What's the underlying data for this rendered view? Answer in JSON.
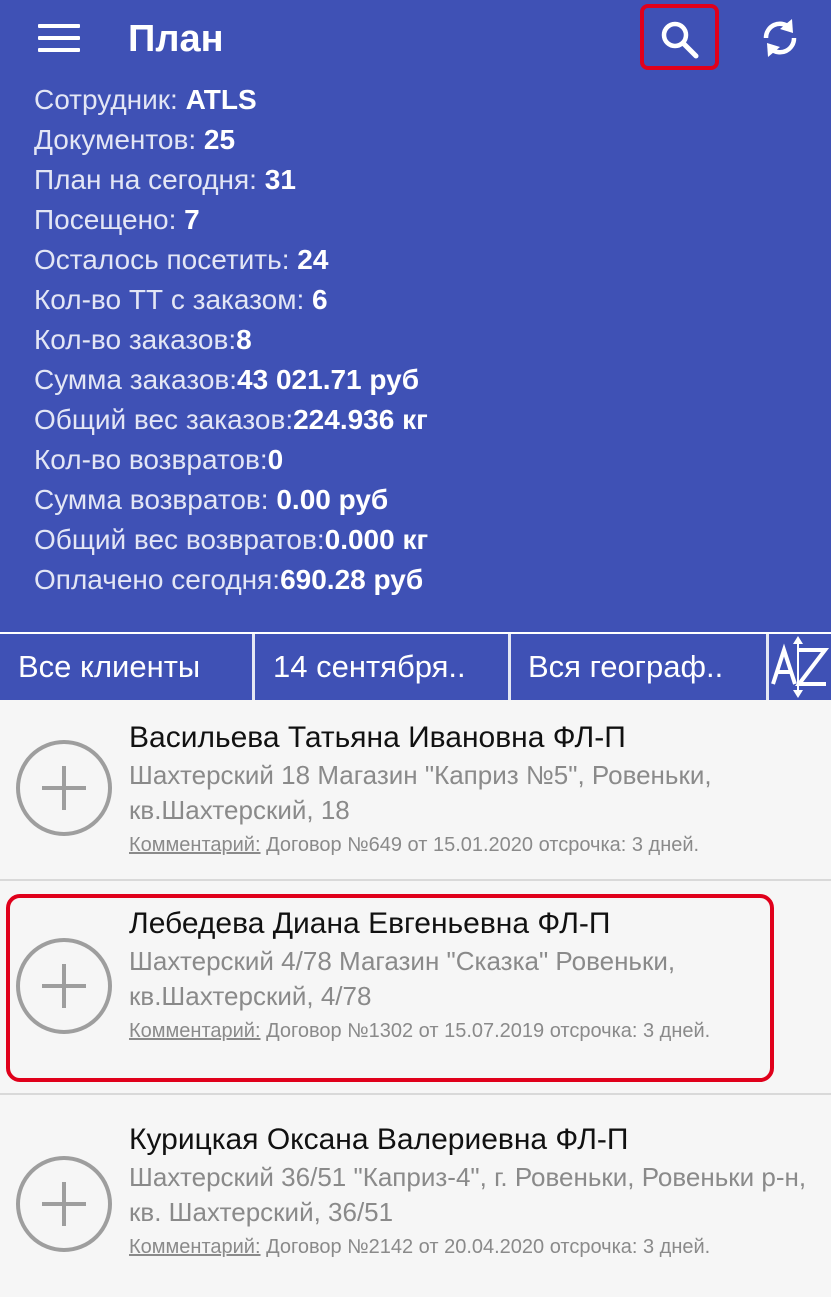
{
  "header": {
    "title": "План",
    "icons": {
      "menu": "menu-icon",
      "search": "search-icon",
      "sync": "sync-icon"
    },
    "highlight_color": "#e0001b",
    "background_color": "#3f51b5"
  },
  "stats": [
    {
      "label": "Сотрудник: ",
      "value": "ATLS"
    },
    {
      "label": "Документов: ",
      "value": "25"
    },
    {
      "label": "План на сегодня: ",
      "value": "31"
    },
    {
      "label": "Посещено: ",
      "value": "7"
    },
    {
      "label": "Осталось посетить: ",
      "value": "24"
    },
    {
      "label": "Кол-во ТТ с заказом: ",
      "value": "6"
    },
    {
      "label": "Кол-во заказов:",
      "value": "8"
    },
    {
      "label": "Сумма заказов:",
      "value": "43 021.71 руб"
    },
    {
      "label": "Общий вес заказов:",
      "value": "224.936 кг"
    },
    {
      "label": "Кол-во возвратов:",
      "value": "0"
    },
    {
      "label": "Сумма возвратов: ",
      "value": "0.00 руб"
    },
    {
      "label": "Общий вес возвратов:",
      "value": "0.000 кг"
    },
    {
      "label": "Оплачено сегодня:",
      "value": "690.28 руб"
    }
  ],
  "filters": {
    "clients": "Все клиенты",
    "date": "14 сентября..",
    "geography": "Вся географ..",
    "sort_icon": "sort-az-icon"
  },
  "clients": [
    {
      "name": "Васильева Татьяна Ивановна ФЛ-П",
      "address": "Шахтерский 18 Магазин \"Каприз №5\", Ровеньки, кв.Шахтерский, 18",
      "comment_label": "Комментарий:",
      "comment": " Договор №649 от 15.01.2020 отсрочка: 3 дней."
    },
    {
      "name": "Лебедева Диана Евгеньевна ФЛ-П",
      "address": "Шахтерский 4/78 Магазин \"Сказка\" Ровеньки, кв.Шахтерский, 4/78",
      "comment_label": "Комментарий:",
      "comment": " Договор №1302 от 15.07.2019 отсрочка: 3 дней."
    },
    {
      "name": "Курицкая Оксана Валериевна ФЛ-П",
      "address": "Шахтерский 36/51 \"Каприз-4\", г. Ровеньки, Ровеньки р-н, кв. Шахтерский, 36/51",
      "comment_label": "Комментарий:",
      "comment": " Договор №2142 от 20.04.2020 отсрочка: 3 дней."
    }
  ]
}
